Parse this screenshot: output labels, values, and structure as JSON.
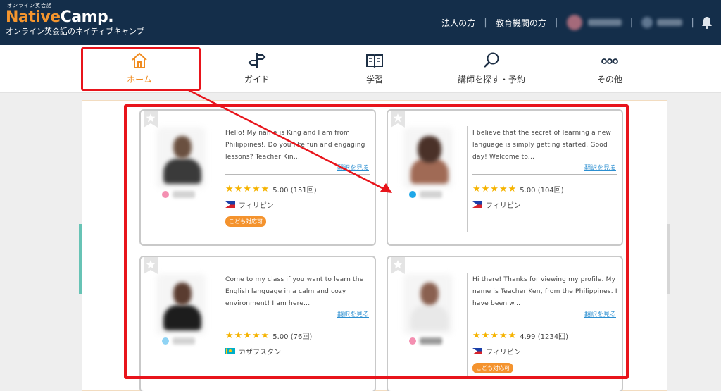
{
  "header": {
    "logo_top": "オンライン英会話",
    "logo_native": "Native",
    "logo_camp": "Camp.",
    "logo_sub": "オンライン英会話のネイティブキャンプ",
    "link_corporate": "法人の方",
    "link_education": "教育機関の方",
    "bell_icon": "bell-icon"
  },
  "nav": {
    "items": [
      {
        "label": "ホーム",
        "icon": "home-icon",
        "active": true
      },
      {
        "label": "ガイド",
        "icon": "signpost-icon",
        "active": false
      },
      {
        "label": "学習",
        "icon": "book-icon",
        "active": false
      },
      {
        "label": "講師を探す・予約",
        "icon": "search-icon",
        "active": false
      },
      {
        "label": "その他",
        "icon": "more-icon",
        "active": false
      }
    ]
  },
  "colors": {
    "header_bg": "#142e4a",
    "accent_orange": "#f08c21",
    "highlight_red": "#e8141b",
    "star_gold": "#f5b300",
    "link_blue": "#2c8fd1"
  },
  "cards": [
    {
      "intro": "Hello! My name is King and I am from Philippines!. Do you like fun and engaging lessons? Teacher Kin...",
      "translate": "翻訳を見る",
      "stars": "★★★★★",
      "score": "5.00 (151回)",
      "country": "フィリピン",
      "flag": "philippines",
      "kids_badge": "こども対応可",
      "status_color": "#f48fb1"
    },
    {
      "intro": "I believe that the secret of learning a new language is simply getting started. Good day! Welcome to...",
      "translate": "翻訳を見る",
      "stars": "★★★★★",
      "score": "5.00 (104回)",
      "country": "フィリピン",
      "flag": "philippines",
      "kids_badge": "",
      "status_color": "#1ea7e8"
    },
    {
      "intro": "Come to my class if you want to learn the English language in a calm and cozy environment! I am here...",
      "translate": "翻訳を見る",
      "stars": "★★★★★",
      "score": "5.00 (76回)",
      "country": "カザフスタン",
      "flag": "kazakhstan",
      "kids_badge": "",
      "status_color": "#8fd3f4"
    },
    {
      "intro": "Hi there! Thanks for viewing my profile. My name is Teacher Ken, from the Philippines. I have been w...",
      "translate": "翻訳を見る",
      "stars": "★★★★★",
      "score": "4.99 (1234回)",
      "country": "フィリピン",
      "flag": "philippines",
      "kids_badge": "こども対応可",
      "status_color": "#f48fb1"
    }
  ]
}
